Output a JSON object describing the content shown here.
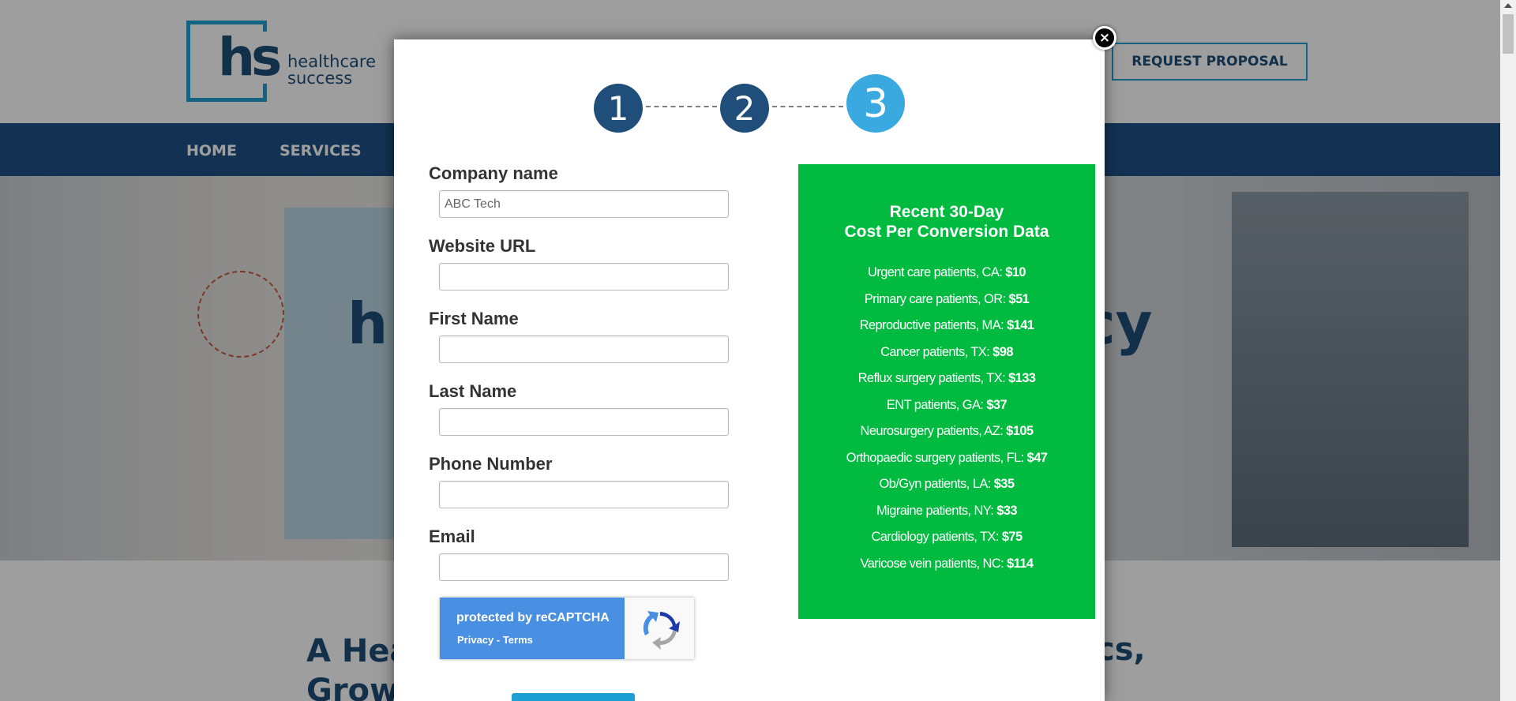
{
  "header": {
    "logo_mark": "hs",
    "logo_line1": "healthcare",
    "logo_line2": "success",
    "cta_label": "REQUEST PROPOSAL"
  },
  "nav": {
    "items": [
      "HOME",
      "SERVICES"
    ]
  },
  "hero": {
    "partial_left": "h",
    "partial_right": "cy"
  },
  "content": {
    "partial_line1_left": "A Hea",
    "partial_line2_left": "Grow",
    "partial_line1_right": "cs,"
  },
  "modal": {
    "close_label": "×",
    "steps": [
      "1",
      "2",
      "3"
    ],
    "active_step": 3,
    "fields": {
      "company": {
        "label": "Company name",
        "placeholder": "ABC Tech",
        "value": ""
      },
      "website": {
        "label": "Website URL",
        "value": ""
      },
      "first_name": {
        "label": "First Name",
        "value": ""
      },
      "last_name": {
        "label": "Last Name",
        "value": ""
      },
      "phone": {
        "label": "Phone Number",
        "value": ""
      },
      "email": {
        "label": "Email",
        "value": ""
      }
    },
    "recaptcha": {
      "title": "protected by reCAPTCHA",
      "privacy": "Privacy",
      "separator": " - ",
      "terms": "Terms"
    }
  },
  "conversion_panel": {
    "title_line1": "Recent 30-Day",
    "title_line2": "Cost Per Conversion Data",
    "rows": [
      {
        "label": "Urgent care patients, CA: ",
        "value": "$10"
      },
      {
        "label": "Primary care patients, OR: ",
        "value": "$51"
      },
      {
        "label": "Reproductive patients, MA: ",
        "value": "$141"
      },
      {
        "label": "Cancer patients, TX: ",
        "value": "$98"
      },
      {
        "label": "Reflux surgery patients, TX: ",
        "value": "$133"
      },
      {
        "label": "ENT patients, GA: ",
        "value": "$37"
      },
      {
        "label": "Neurosurgery patients, AZ: ",
        "value": "$105"
      },
      {
        "label": "Orthopaedic surgery patients, FL: ",
        "value": "$47"
      },
      {
        "label": "Ob/Gyn patients, LA: ",
        "value": "$35"
      },
      {
        "label": "Migraine patients, NY: ",
        "value": "$33"
      },
      {
        "label": "Cardiology patients, TX: ",
        "value": "$75"
      },
      {
        "label": "Varicose vein patients, NC: ",
        "value": "$114"
      }
    ]
  },
  "colors": {
    "brand_navy": "#1f4e7a",
    "brand_blue": "#1fa0d4",
    "active_step": "#3aa9e0",
    "panel_green": "#00bb3f",
    "recaptcha_blue": "#4a90e2"
  }
}
